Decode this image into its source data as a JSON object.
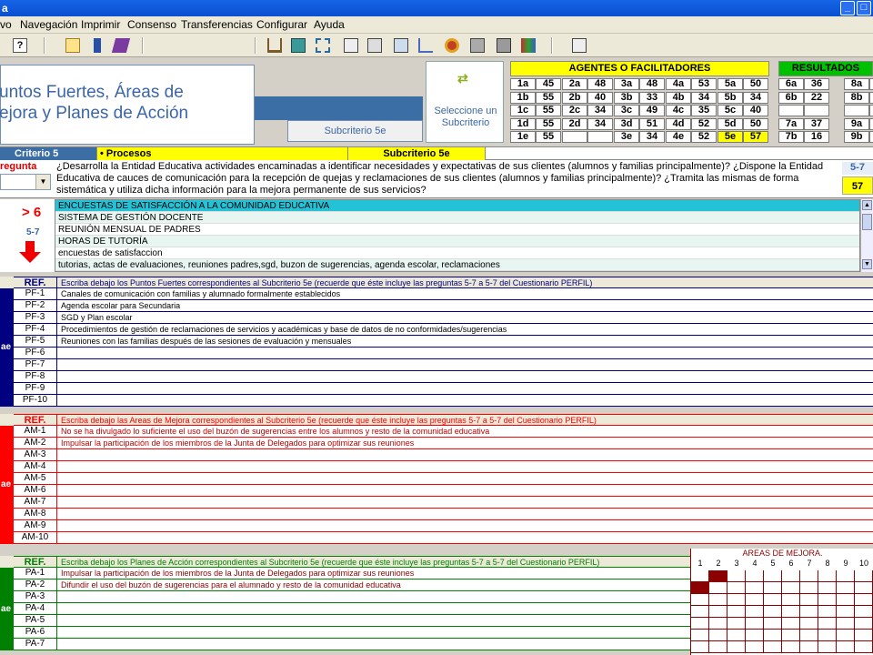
{
  "window": {
    "title": "a"
  },
  "menu": [
    "vo",
    "Navegación",
    "Imprimir",
    "Consenso",
    "Transferencias",
    "Configurar",
    "Ayuda"
  ],
  "header": {
    "title": "untos Fuertes, Áreas de\nejora y Planes de Acción",
    "subcriterio_label": "Subcriterio 5e",
    "select_label": "Seleccione un Subcriterio"
  },
  "agentes": {
    "title": "AGENTES O FACILITADORES",
    "rows": [
      [
        [
          "1a",
          "45"
        ],
        [
          "2a",
          "48"
        ],
        [
          "3a",
          "48"
        ],
        [
          "4a",
          "53"
        ],
        [
          "5a",
          "50"
        ]
      ],
      [
        [
          "1b",
          "55"
        ],
        [
          "2b",
          "40"
        ],
        [
          "3b",
          "33"
        ],
        [
          "4b",
          "34"
        ],
        [
          "5b",
          "34"
        ]
      ],
      [
        [
          "1c",
          "55"
        ],
        [
          "2c",
          "34"
        ],
        [
          "3c",
          "49"
        ],
        [
          "4c",
          "35"
        ],
        [
          "5c",
          "40"
        ]
      ],
      [
        [
          "1d",
          "55"
        ],
        [
          "2d",
          "34"
        ],
        [
          "3d",
          "51"
        ],
        [
          "4d",
          "52"
        ],
        [
          "5d",
          "50"
        ]
      ],
      [
        [
          "1e",
          "55"
        ],
        [
          "",
          ""
        ],
        [
          "3e",
          "34"
        ],
        [
          "4e",
          "52"
        ],
        [
          "5e",
          "57"
        ]
      ]
    ]
  },
  "resultados": {
    "title": "RESULTADOS",
    "rows": [
      [
        [
          "6a",
          "36"
        ],
        [
          "8a",
          ""
        ]
      ],
      [
        [
          "6b",
          "22"
        ],
        [
          "8b",
          ""
        ]
      ],
      [
        [
          "",
          ""
        ],
        [
          "",
          ""
        ]
      ],
      [
        [
          "7a",
          "37"
        ],
        [
          "9a",
          ""
        ]
      ],
      [
        [
          "7b",
          "16"
        ],
        [
          "9b",
          ""
        ]
      ]
    ]
  },
  "criterio_bar": {
    "criterio": "Criterio  5",
    "procesos": "• Procesos",
    "subcriterio": "Subcriterio 5e"
  },
  "question": {
    "label": "regunta",
    "text": "¿Desarrolla la Entidad Educativa actividades encaminadas a identificar necesidades y expectativas de sus clientes (alumnos y familias principalmente)? ¿Dispone la Entidad Educativa de cauces de comunicación para la recepción de quejas y reclamaciones de sus clientes (alumnos y familias principalmente)? ¿Tramita las mismas de forma sistemática y utiliza dicha información para la mejora permanente de sus servicios?",
    "range": "5-7",
    "score": "57"
  },
  "evidence": {
    "indicator": "> 6",
    "range": "5-7",
    "items": [
      "ENCUESTAS DE SATISFACCIÓN A LA COMUNIDAD EDUCATIVA",
      "SISTEMA DE GESTIÓN DOCENTE",
      "REUNIÓN MENSUAL DE PADRES",
      "HORAS DE TUTORÍA",
      "encuestas de satisfaccion",
      "tutorias, actas de evaluaciones, reuniones padres,sgd, buzon de sugerencias, agenda escolar, reclamaciones"
    ]
  },
  "puntos_fuertes": {
    "header_ref": "REF.",
    "header_text": "Escriba debajo los Puntos Fuertes correspondientes al Subcriterio 5e (recuerde que éste incluye las preguntas 5-7 a 5-7 del Cuestionario PERFIL)",
    "rows": [
      {
        "ref": "PF-1",
        "text": "Canales de comunicación con familias y alumnado formalmente establecidos"
      },
      {
        "ref": "PF-2",
        "text": "Agenda escolar para Secundaria"
      },
      {
        "ref": "PF-3",
        "text": "SGD y Plan escolar"
      },
      {
        "ref": "PF-4",
        "text": "Procedimientos de gestión de reclamaciones de servicios y académicas y base de datos de no conformidades/sugerencias"
      },
      {
        "ref": "PF-5",
        "text": "Reuniones con las familias después de las sesiones de evaluación y mensuales"
      },
      {
        "ref": "PF-6",
        "text": ""
      },
      {
        "ref": "PF-7",
        "text": ""
      },
      {
        "ref": "PF-8",
        "text": ""
      },
      {
        "ref": "PF-9",
        "text": ""
      },
      {
        "ref": "PF-10",
        "text": ""
      }
    ]
  },
  "areas_mejora": {
    "header_ref": "REF.",
    "header_text": "Escriba debajo las Areas de Mejora correspondientes al Subcriterio 5e (recuerde que éste incluye las preguntas 5-7 a 5-7 del Cuestionario PERFIL)",
    "rows": [
      {
        "ref": "AM-1",
        "text": "No se ha divulgado lo suficiente el uso del buzón de sugerencias entre los alumnos y resto de la comunidad educativa"
      },
      {
        "ref": "AM-2",
        "text": "Impulsar la participación de los miembros de la Junta de Delegados para optimizar sus reuniones"
      },
      {
        "ref": "AM-3",
        "text": ""
      },
      {
        "ref": "AM-4",
        "text": ""
      },
      {
        "ref": "AM-5",
        "text": ""
      },
      {
        "ref": "AM-6",
        "text": ""
      },
      {
        "ref": "AM-7",
        "text": ""
      },
      {
        "ref": "AM-8",
        "text": ""
      },
      {
        "ref": "AM-9",
        "text": ""
      },
      {
        "ref": "AM-10",
        "text": ""
      }
    ]
  },
  "planes_accion": {
    "header_ref": "REF.",
    "header_text": "Escriba debajo los Planes de Acción correspondientes al Subcriterio 5e (recuerde que éste incluye las preguntas 5-7 a 5-7 del Cuestionario PERFIL)",
    "rows": [
      {
        "ref": "PA-1",
        "text": "Impulsar la participación de los miembros de la Junta de Delegados para optimizar sus reuniones"
      },
      {
        "ref": "PA-2",
        "text": "Difundir el uso del buzón de sugerencias para el alumnado y resto de la comunidad educativa"
      },
      {
        "ref": "PA-3",
        "text": ""
      },
      {
        "ref": "PA-4",
        "text": ""
      },
      {
        "ref": "PA-5",
        "text": ""
      },
      {
        "ref": "PA-6",
        "text": ""
      },
      {
        "ref": "PA-7",
        "text": ""
      }
    ],
    "matrix_title": "AREAS DE MEJORA.",
    "matrix_cols": [
      "1",
      "2",
      "3",
      "4",
      "5",
      "6",
      "7",
      "8",
      "9",
      "10"
    ],
    "matrix_links": [
      [
        0,
        1
      ],
      [
        1,
        0
      ]
    ]
  },
  "section_bar_text": "ae",
  "colors": {
    "pf": "#000080",
    "am": "#ff0000",
    "pa": "#008000",
    "am_dark": "#8b0000"
  }
}
